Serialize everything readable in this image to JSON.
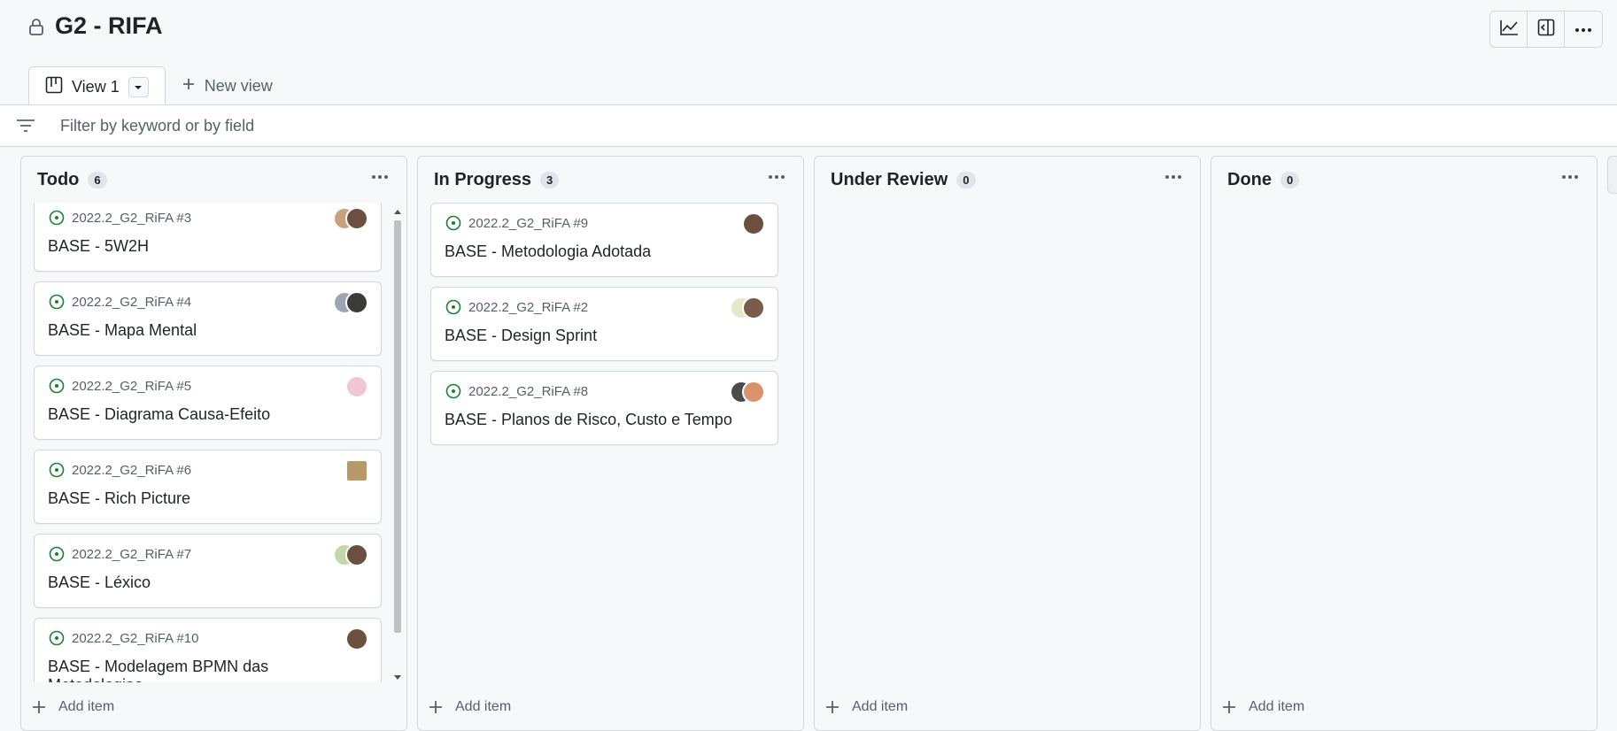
{
  "project": {
    "title": "G2 - RIFA"
  },
  "toolbar": {
    "insights_icon": "graph-icon",
    "side_panel_icon": "sidebar-expand-icon",
    "menu_icon": "kebab-horizontal-icon"
  },
  "tabs": [
    {
      "label": "View 1",
      "icon": "project-board-icon"
    }
  ],
  "new_view": {
    "label": "New view"
  },
  "filter": {
    "placeholder": "Filter by keyword or by field",
    "value": ""
  },
  "colors": {
    "open_issue": "#1a7f37",
    "border": "#d0d7de",
    "muted_text": "#57606a"
  },
  "columns": [
    {
      "name": "Todo",
      "count": "6",
      "add_label": "Add item",
      "cards": [
        {
          "ref": "2022.2_G2_RiFA #3",
          "title": "BASE - 5W2H",
          "avatars": [
            "#c7a27c",
            "#6b4f3f"
          ]
        },
        {
          "ref": "2022.2_G2_RiFA #4",
          "title": "BASE - Mapa Mental",
          "avatars": [
            "#9aa6b2",
            "#3d3a3a"
          ]
        },
        {
          "ref": "2022.2_G2_RiFA #5",
          "title": "BASE - Diagrama Causa-Efeito",
          "avatars": [
            "#f3c6d3"
          ]
        },
        {
          "ref": "2022.2_G2_RiFA #6",
          "title": "BASE - Rich Picture",
          "avatars": [
            "#b89a6a"
          ]
        },
        {
          "ref": "2022.2_G2_RiFA #7",
          "title": "BASE - Léxico",
          "avatars": [
            "#bfd9a8",
            "#6b4f3f"
          ]
        },
        {
          "ref": "2022.2_G2_RiFA #10",
          "title": "BASE - Modelagem BPMN das Metodologias",
          "avatars": [
            "#6b4f3f"
          ]
        }
      ]
    },
    {
      "name": "In Progress",
      "count": "3",
      "add_label": "Add item",
      "cards": [
        {
          "ref": "2022.2_G2_RiFA #9",
          "title": "BASE - Metodologia Adotada",
          "avatars": [
            "#6b4f3f"
          ]
        },
        {
          "ref": "2022.2_G2_RiFA #2",
          "title": "BASE - Design Sprint",
          "avatars": [
            "#e3e8c8",
            "#7a5a4a"
          ]
        },
        {
          "ref": "2022.2_G2_RiFA #8",
          "title": "BASE - Planos de Risco, Custo e Tempo",
          "avatars": [
            "#4b4b4b",
            "#d9936a"
          ]
        }
      ]
    },
    {
      "name": "Under Review",
      "count": "0",
      "add_label": "Add item",
      "cards": []
    },
    {
      "name": "Done",
      "count": "0",
      "add_label": "Add item",
      "cards": []
    }
  ]
}
